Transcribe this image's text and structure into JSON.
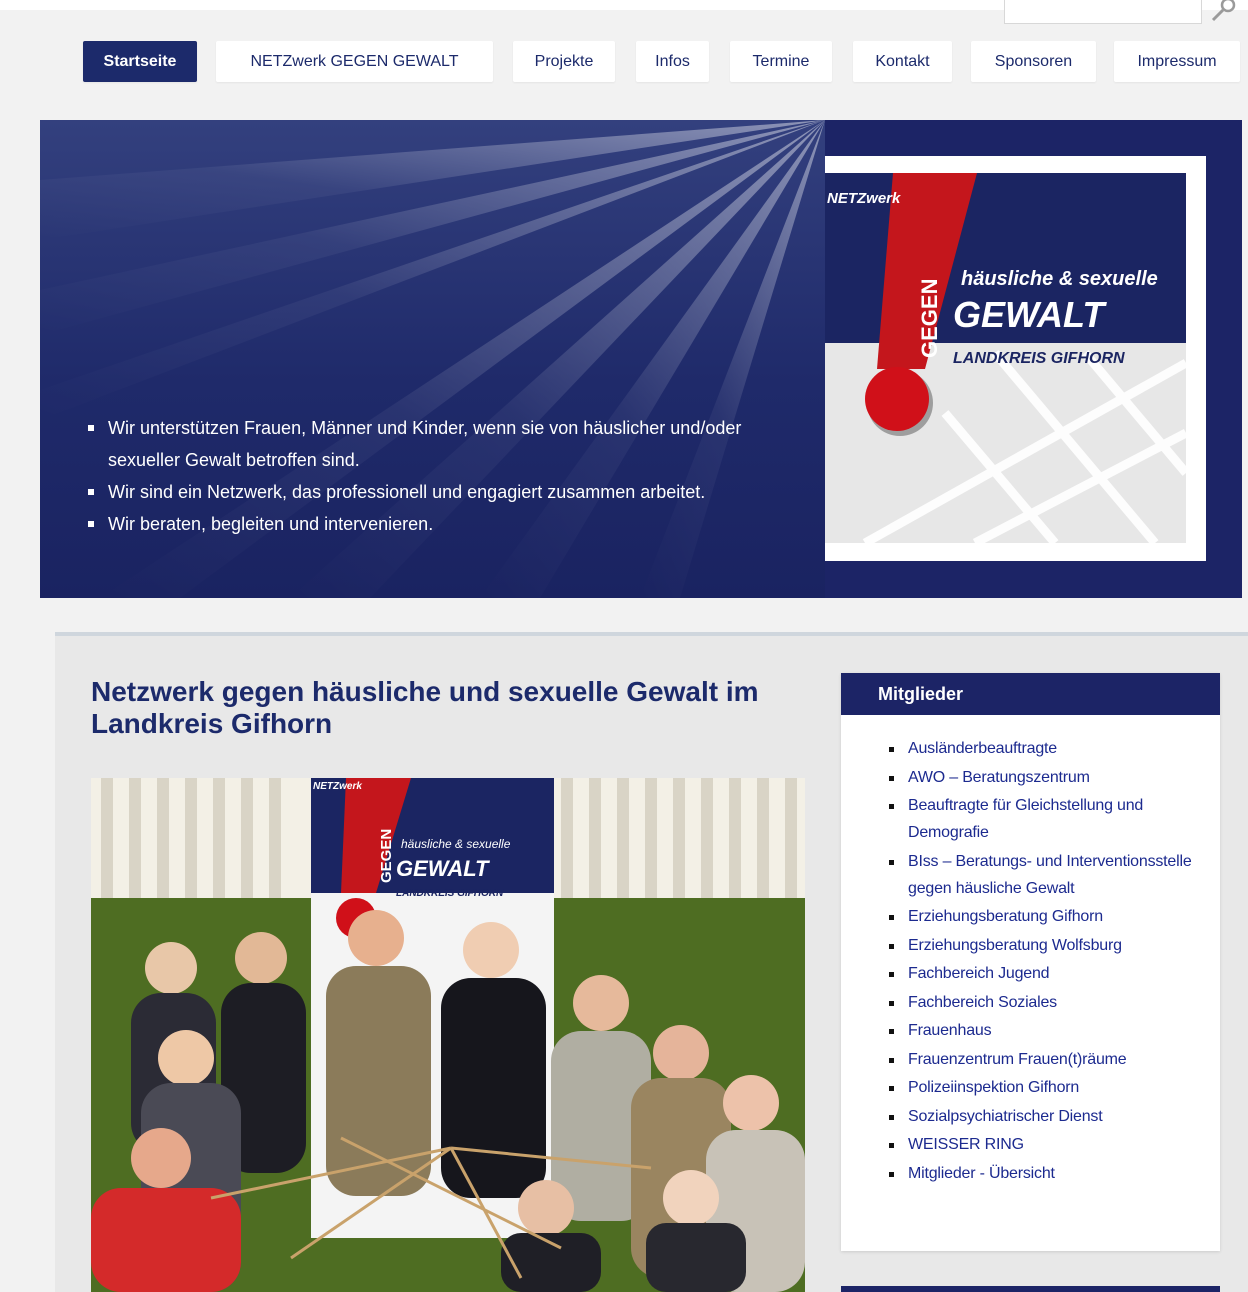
{
  "nav": {
    "items": [
      "Startseite",
      "NETZwerk GEGEN GEWALT",
      "Projekte",
      "Infos",
      "Termine",
      "Kontakt",
      "Sponsoren",
      "Impressum"
    ],
    "active_index": 0
  },
  "hero": {
    "bullets": [
      "Wir unterstützen Frauen, Männer und Kinder, wenn sie von häuslicher und/oder sexueller Gewalt betroffen sind.",
      "Wir sind ein Netzwerk, das professionell und engagiert zusammen arbeitet.",
      "Wir beraten, begleiten und intervenieren."
    ],
    "logo": {
      "brand": "NETZwerk",
      "gegen": "GEGEN",
      "subtitle": "häusliche & sexuelle",
      "gewalt": "GEWALT",
      "region": "LANDKREIS GIFHORN"
    }
  },
  "main": {
    "title": "Netzwerk gegen häusliche und sexuelle Gewalt im Landkreis Gifhorn",
    "photo_banner": {
      "brand": "NETZwerk",
      "gegen": "GEGEN",
      "subtitle": "häusliche & sexuelle",
      "gewalt": "GEWALT",
      "region": "LANDKREIS GIFHORN"
    }
  },
  "sidebar": {
    "heading": "Mitglieder",
    "items": [
      "Ausländerbeauftragte",
      "AWO – Beratungszentrum",
      "Beauftragte für Gleichstellung und Demografie",
      "BIss – Beratungs- und Interventionsstelle gegen häusliche Gewalt",
      "Erziehungsberatung Gifhorn",
      "Erziehungsberatung Wolfsburg",
      "Fachbereich Jugend",
      "Fachbereich Soziales",
      "Frauenhaus",
      "Frauenzentrum Frauen(t)räume",
      "Polizeiinspektion Gifhorn",
      "Sozialpsychiatrischer Dienst",
      "WEISSER RING",
      "Mitglieder - Übersicht"
    ]
  },
  "colors": {
    "navy": "#1c2466",
    "link": "#1c2a8f",
    "logo_red": "#c4161c"
  }
}
